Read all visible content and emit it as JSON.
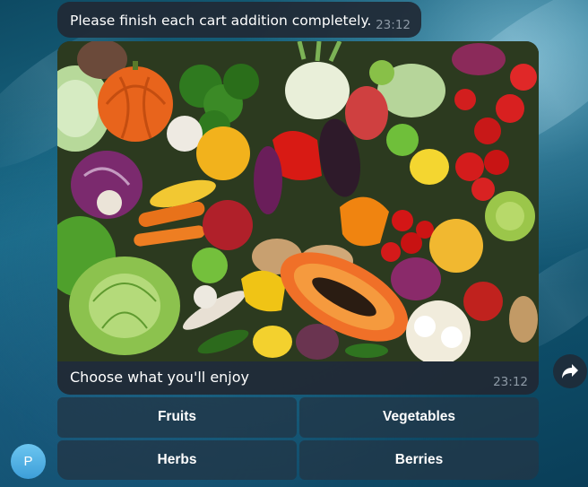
{
  "messages": {
    "top": {
      "text": "Please finish each cart addition completely.",
      "time": "23:12"
    },
    "media": {
      "caption": "Choose what you'll enjoy",
      "time": "23:12",
      "image_icon": "vegetables-photo"
    }
  },
  "keyboard": {
    "buttons": [
      {
        "label": "Fruits"
      },
      {
        "label": "Vegetables"
      },
      {
        "label": "Herbs"
      },
      {
        "label": "Berries"
      }
    ]
  },
  "user": {
    "avatar_letter": "P"
  },
  "actions": {
    "share_icon": "share-arrow-icon"
  },
  "colors": {
    "bubble": "#212935",
    "button": "#213748",
    "time": "#8e9aa6",
    "avatar": "#4aa8e0"
  }
}
